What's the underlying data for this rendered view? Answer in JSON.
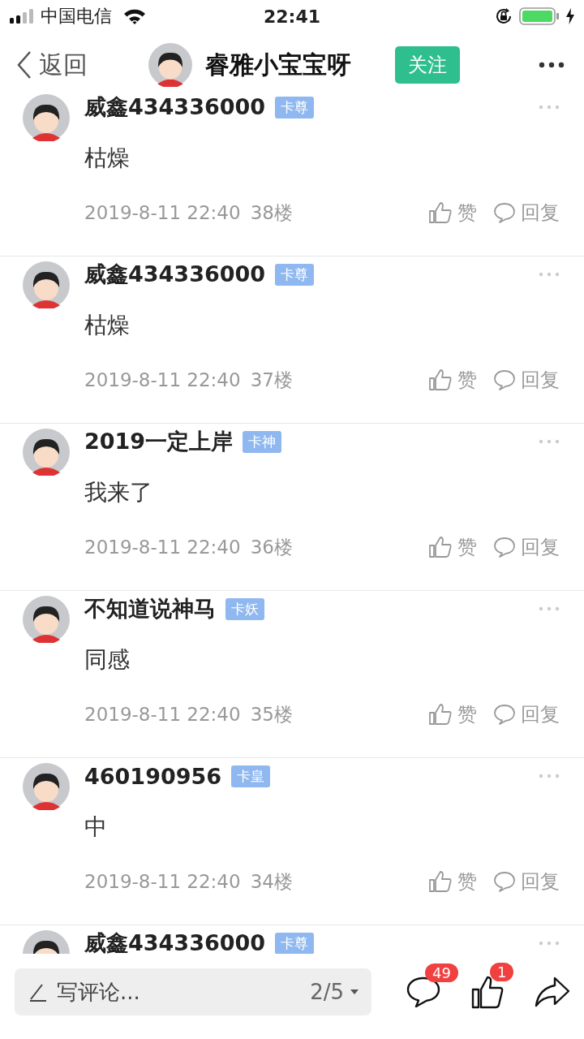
{
  "status_bar": {
    "carrier": "中国电信",
    "time": "22:41"
  },
  "header": {
    "back": "返回",
    "title": "睿雅小宝宝呀",
    "follow": "关注"
  },
  "comments": [
    {
      "name": "威鑫434336000",
      "badge": "卡尊",
      "text": "枯燥",
      "time": "2019-8-11 22:40",
      "floor": "38楼",
      "like": "赞",
      "reply": "回复"
    },
    {
      "name": "威鑫434336000",
      "badge": "卡尊",
      "text": "枯燥",
      "time": "2019-8-11 22:40",
      "floor": "37楼",
      "like": "赞",
      "reply": "回复"
    },
    {
      "name": "2019一定上岸",
      "badge": "卡神",
      "text": "我来了",
      "time": "2019-8-11 22:40",
      "floor": "36楼",
      "like": "赞",
      "reply": "回复"
    },
    {
      "name": "不知道说神马",
      "badge": "卡妖",
      "text": "同感",
      "time": "2019-8-11 22:40",
      "floor": "35楼",
      "like": "赞",
      "reply": "回复"
    },
    {
      "name": "460190956",
      "badge": "卡皇",
      "text": "中",
      "time": "2019-8-11 22:40",
      "floor": "34楼",
      "like": "赞",
      "reply": "回复"
    },
    {
      "name": "威鑫434336000",
      "badge": "卡尊"
    }
  ],
  "bottom_bar": {
    "placeholder": "写评论...",
    "page": "2/5",
    "comment_count": "49",
    "like_count": "1"
  }
}
